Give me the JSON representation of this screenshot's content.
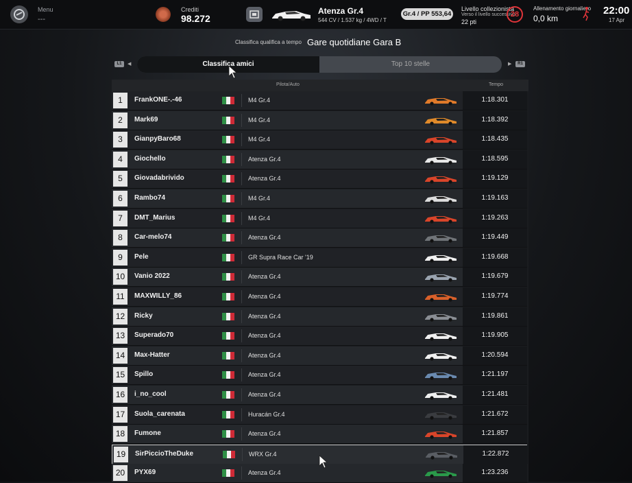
{
  "topbar": {
    "menu_label": "Menu",
    "menu_value": "---",
    "credits_label": "Crediti",
    "credits_value": "98.272",
    "car_name": "Atenza Gr.4",
    "car_specs": "544 CV / 1.537 kg / 4WD / T",
    "pp_badge": "Gr.4 / PP 553,64",
    "level_title": "Livello collezionista",
    "level_next": "Verso il livello successivo",
    "level_pts": "22 pti",
    "level_number": "28",
    "daily_title": "Allenamento giornaliero",
    "daily_value": "0,0 km",
    "time": "22:00",
    "date": "17 Apr"
  },
  "header": {
    "subtitle": "Classifica qualifica a tempo",
    "title": "Gare quotidiane Gara B",
    "l1_label": "L1",
    "r1_label": "R1"
  },
  "tabs": [
    {
      "label": "Classifica amici",
      "active": true
    },
    {
      "label": "Top 10 stelle",
      "active": false
    }
  ],
  "table": {
    "col_pilot": "Pilota/Auto",
    "col_time": "Tempo",
    "rows": [
      {
        "pos": "1",
        "name": "FrankONE-.-46",
        "car": "M4 Gr.4",
        "time": "1:18.301",
        "livery": "#e07a2a"
      },
      {
        "pos": "2",
        "name": "Mark69",
        "car": "M4 Gr.4",
        "time": "1:18.392",
        "livery": "#e08a2a"
      },
      {
        "pos": "3",
        "name": "GianpyBaro68",
        "car": "M4 Gr.4",
        "time": "1:18.435",
        "livery": "#d9452a"
      },
      {
        "pos": "4",
        "name": "Giochello",
        "car": "Atenza Gr.4",
        "time": "1:18.595",
        "livery": "#e8e8e8"
      },
      {
        "pos": "5",
        "name": "Giovadabrivido",
        "car": "Atenza Gr.4",
        "time": "1:19.129",
        "livery": "#d9452a"
      },
      {
        "pos": "6",
        "name": "Rambo74",
        "car": "M4 Gr.4",
        "time": "1:19.163",
        "livery": "#dcdcdc"
      },
      {
        "pos": "7",
        "name": "DMT_Marius",
        "car": "M4 Gr.4",
        "time": "1:19.263",
        "livery": "#d9452a"
      },
      {
        "pos": "8",
        "name": "Car-melo74",
        "car": "Atenza Gr.4",
        "time": "1:19.449",
        "livery": "#707478"
      },
      {
        "pos": "9",
        "name": "Pele",
        "car": "GR Supra Race Car '19",
        "time": "1:19.668",
        "livery": "#f0f0f0"
      },
      {
        "pos": "10",
        "name": "Vanio 2022",
        "car": "Atenza Gr.4",
        "time": "1:19.679",
        "livery": "#9aa4b0"
      },
      {
        "pos": "11",
        "name": "MAXWILLY_86",
        "car": "Atenza Gr.4",
        "time": "1:19.774",
        "livery": "#d9602a"
      },
      {
        "pos": "12",
        "name": "Ricky",
        "car": "Atenza Gr.4",
        "time": "1:19.861",
        "livery": "#8a8e94"
      },
      {
        "pos": "13",
        "name": "Superado70",
        "car": "Atenza Gr.4",
        "time": "1:19.905",
        "livery": "#f0f0f0"
      },
      {
        "pos": "14",
        "name": "Max-Hatter",
        "car": "Atenza Gr.4",
        "time": "1:20.594",
        "livery": "#f0f0f0"
      },
      {
        "pos": "15",
        "name": "Spillo",
        "car": "Atenza Gr.4",
        "time": "1:21.197",
        "livery": "#6a8ab0"
      },
      {
        "pos": "16",
        "name": "i_no_cool",
        "car": "Atenza Gr.4",
        "time": "1:21.481",
        "livery": "#f0f0f0"
      },
      {
        "pos": "17",
        "name": "Suola_carenata",
        "car": "Huracán Gr.4",
        "time": "1:21.672",
        "livery": "#3a3c40"
      },
      {
        "pos": "18",
        "name": "Fumone",
        "car": "Atenza Gr.4",
        "time": "1:21.857",
        "livery": "#d9452a"
      },
      {
        "pos": "19",
        "name": "SirPiccioTheDuke",
        "car": "WRX Gr.4",
        "time": "1:22.872",
        "livery": "#5a5e64"
      },
      {
        "pos": "20",
        "name": "PYX69",
        "car": "Atenza Gr.4",
        "time": "1:23.236",
        "livery": "#2a9a4a"
      }
    ]
  },
  "colors": {
    "flag_green": "#2f8f46",
    "flag_white": "#f2f2f2",
    "flag_red": "#cf2b37",
    "accent_red": "#e0353a"
  }
}
